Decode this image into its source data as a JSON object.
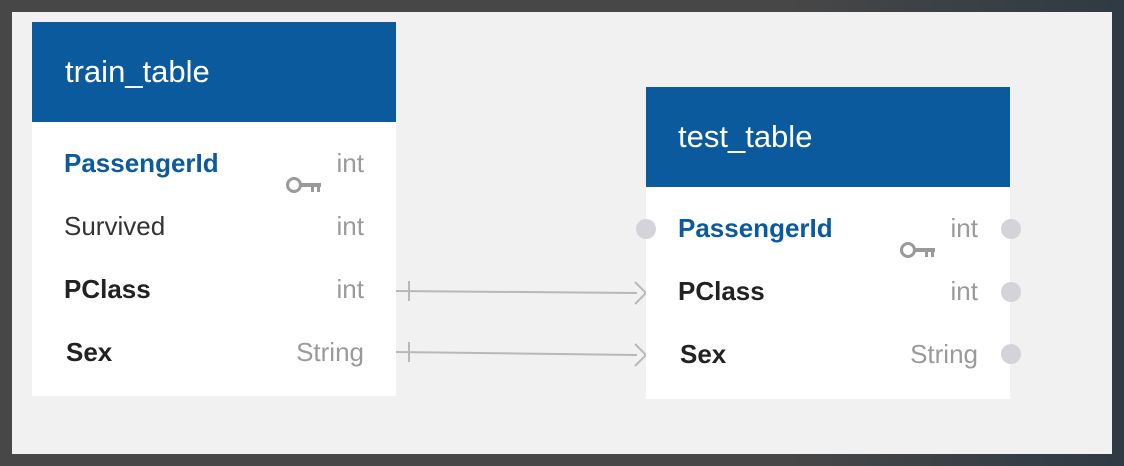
{
  "tables": [
    {
      "name": "train_table",
      "fields": [
        {
          "name": "PassengerId",
          "type": "int",
          "primary_key": true
        },
        {
          "name": "Survived",
          "type": "int",
          "primary_key": false
        },
        {
          "name": "PClass",
          "type": "int",
          "primary_key": false
        },
        {
          "name": "Sex",
          "type": "String",
          "primary_key": false
        }
      ]
    },
    {
      "name": "test_table",
      "fields": [
        {
          "name": "PassengerId",
          "type": "int",
          "primary_key": true
        },
        {
          "name": "PClass",
          "type": "int",
          "primary_key": false
        },
        {
          "name": "Sex",
          "type": "String",
          "primary_key": false
        }
      ]
    }
  ],
  "relationships": [
    {
      "from": "train_table.PClass",
      "to": "test_table.PClass",
      "from_marker": "one",
      "to_marker": "many"
    },
    {
      "from": "train_table.Sex",
      "to": "test_table.Sex",
      "from_marker": "one",
      "to_marker": "many"
    }
  ],
  "colors": {
    "header": "#0c5a9e",
    "primary_key_text": "#0c5a9e",
    "type_text": "#9a9a9a",
    "connector": "#b8b8b8",
    "port_dot": "#d3d3d9"
  },
  "icons": {
    "primary_key": "key-icon"
  }
}
